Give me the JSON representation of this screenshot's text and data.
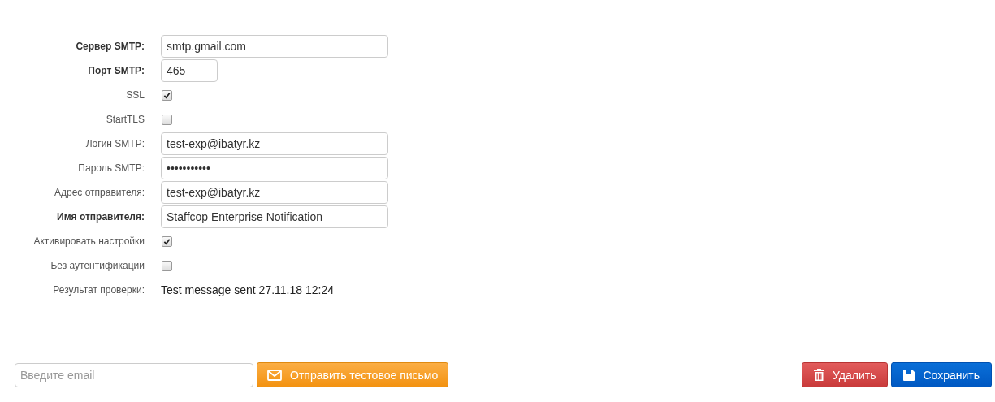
{
  "settings": [
    {
      "label": "Сервер SMTP:",
      "bold": true,
      "kind": "input",
      "value": "smtp.gmail.com"
    },
    {
      "label": "Порт SMTP:",
      "bold": true,
      "kind": "short-input",
      "value": "465"
    },
    {
      "label": "SSL",
      "bold": false,
      "kind": "checkbox",
      "checked": true
    },
    {
      "label": "StartTLS",
      "bold": false,
      "kind": "checkbox",
      "checked": false
    },
    {
      "label": "Логин SMTP:",
      "bold": false,
      "kind": "input",
      "value": "test-exp@ibatyr.kz"
    },
    {
      "label": "Пароль SMTP:",
      "bold": false,
      "kind": "password",
      "value": "•••••••••••"
    },
    {
      "label": "Адрес отправителя:",
      "bold": false,
      "kind": "input",
      "value": "test-exp@ibatyr.kz"
    },
    {
      "label": "Имя отправителя:",
      "bold": true,
      "kind": "input",
      "value": "Staffcop Enterprise Notification"
    },
    {
      "label": "Активировать настройки",
      "bold": false,
      "kind": "checkbox",
      "checked": true
    },
    {
      "label": "Без аутентификации",
      "bold": false,
      "kind": "checkbox",
      "checked": false
    },
    {
      "label": "Результат проверки:",
      "bold": false,
      "kind": "result",
      "value": "Test message sent 27.11.18 12:24"
    }
  ],
  "test_email": {
    "placeholder": "Введите email",
    "button": "Отправить тестовое письмо"
  },
  "buttons": {
    "delete": "Удалить",
    "save": "Сохранить"
  }
}
